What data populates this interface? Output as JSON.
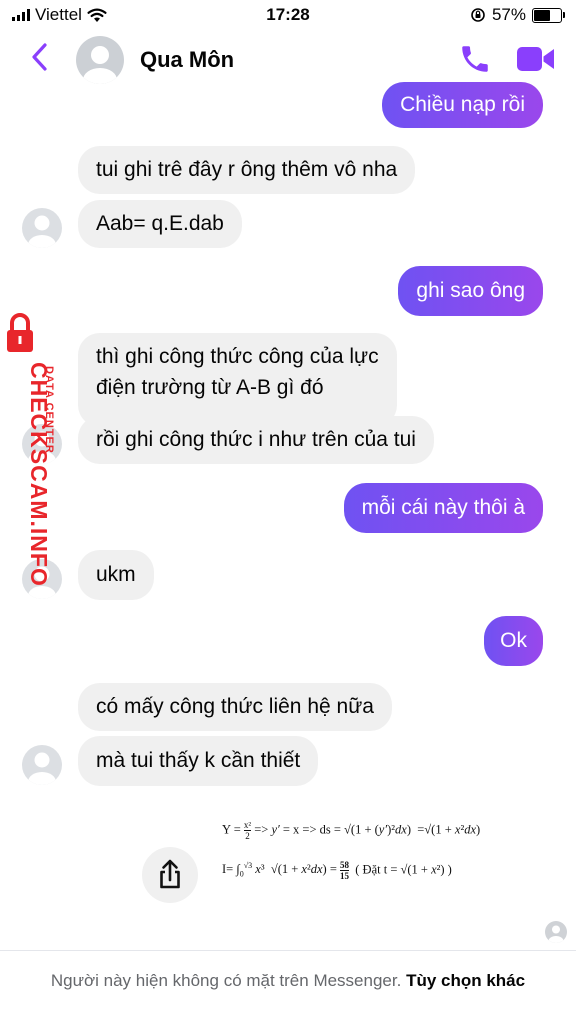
{
  "status_bar": {
    "carrier": "Viettel",
    "time": "17:28",
    "battery_text": "57%",
    "battery_level": 0.57
  },
  "header": {
    "contact_name": "Qua Môn"
  },
  "messages": [
    {
      "side": "out",
      "text": "Chiều nạp rồi"
    },
    {
      "side": "in",
      "text": "tui ghi trê đây r ông thêm vô nha"
    },
    {
      "side": "in",
      "text": "Aab= q.E.dab"
    },
    {
      "side": "out",
      "text": "ghi sao ông"
    },
    {
      "side": "in",
      "lines": [
        "thì ghi công thức công của lực",
        "điện trường từ A-B gì đó"
      ]
    },
    {
      "side": "in",
      "text": "rồi ghi công thức i như trên của tui"
    },
    {
      "side": "out",
      "text": "mỗi cái này thôi à"
    },
    {
      "side": "in",
      "text": "ukm"
    },
    {
      "side": "out",
      "text": "Ok"
    },
    {
      "side": "in",
      "text": "có mấy công thức liên hệ nữa"
    },
    {
      "side": "in",
      "text": "mà tui thấy k cần thiết"
    }
  ],
  "watermark": {
    "line1": "DATA CENTER",
    "line2": "CHECKSCAM.INFO"
  },
  "footer": {
    "text": "Người này hiện không có mặt trên Messenger.",
    "link": "Tùy chọn khác"
  },
  "colors": {
    "accent": "#8a3ffc",
    "bubble_out_start": "#6f52f2",
    "bubble_out_end": "#9a47ec",
    "bubble_in": "#f0f0f0",
    "watermark": "#e8262b"
  }
}
